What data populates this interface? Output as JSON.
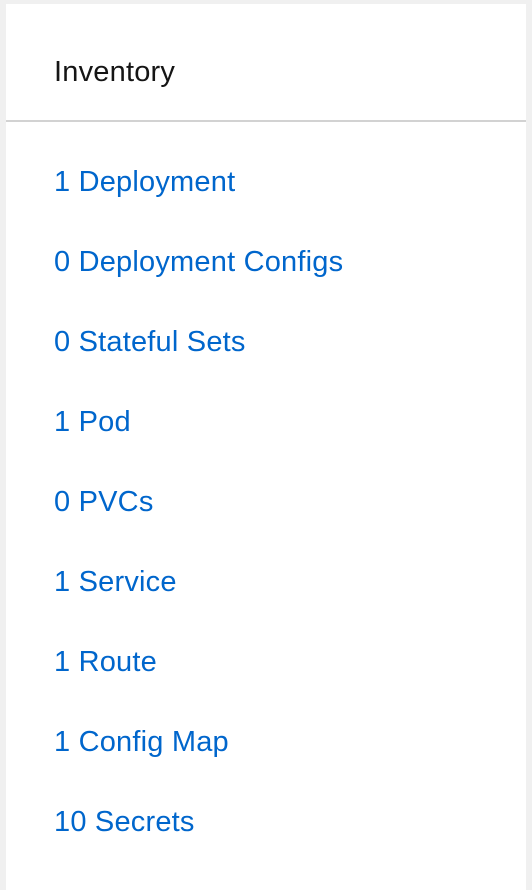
{
  "card": {
    "title": "Inventory",
    "items": [
      {
        "label": "1 Deployment"
      },
      {
        "label": "0 Deployment Configs"
      },
      {
        "label": "0 Stateful Sets"
      },
      {
        "label": "1 Pod"
      },
      {
        "label": "0 PVCs"
      },
      {
        "label": "1 Service"
      },
      {
        "label": "1 Route"
      },
      {
        "label": "1 Config Map"
      },
      {
        "label": "10 Secrets"
      }
    ]
  },
  "colors": {
    "link": "#0066cc",
    "title": "#151515",
    "divider": "#d2d2d2",
    "background": "#f0f0f0",
    "card": "#ffffff"
  }
}
